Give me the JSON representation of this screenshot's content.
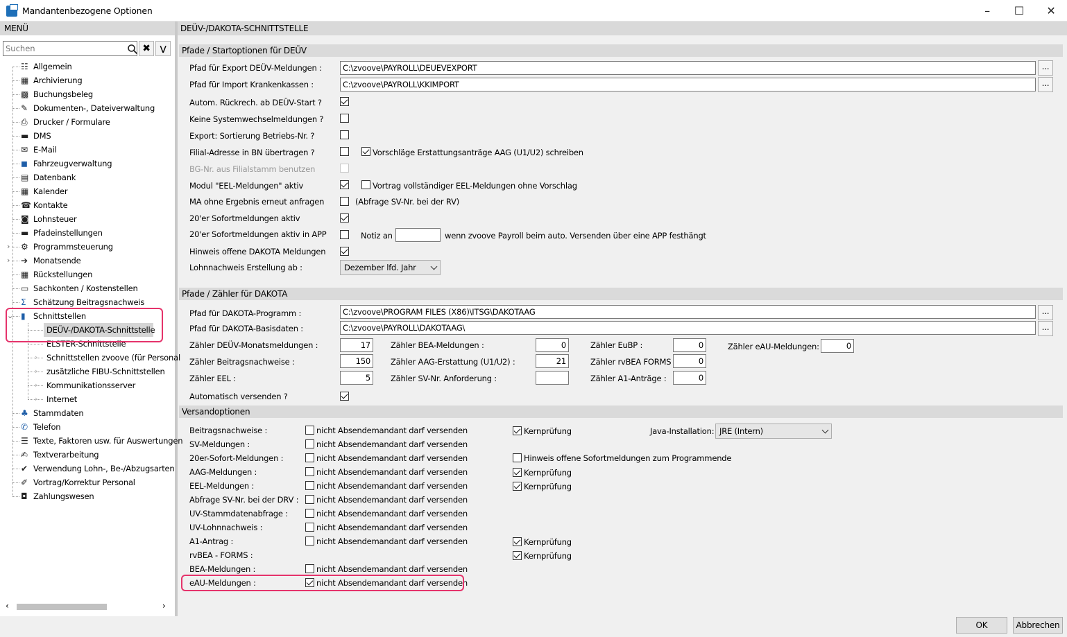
{
  "window": {
    "title": "Mandantenbezogene Optionen"
  },
  "left": {
    "header": "MENÜ",
    "search_placeholder": "Suchen"
  },
  "tree": [
    {
      "label": "Allgemein",
      "icon": "list-icon",
      "level": 0
    },
    {
      "label": "Archivierung",
      "icon": "archive-icon",
      "level": 0
    },
    {
      "label": "Buchungsbeleg",
      "icon": "grid-icon",
      "level": 0
    },
    {
      "label": "Dokumenten-, Dateiverwaltung",
      "icon": "document-icon",
      "level": 0
    },
    {
      "label": "Drucker / Formulare",
      "icon": "printer-icon",
      "level": 0
    },
    {
      "label": "DMS",
      "icon": "folder-icon",
      "level": 0
    },
    {
      "label": "E-Mail",
      "icon": "email-icon",
      "level": 0
    },
    {
      "label": "Fahrzeugverwaltung",
      "icon": "car-icon",
      "level": 0
    },
    {
      "label": "Datenbank",
      "icon": "database-icon",
      "level": 0
    },
    {
      "label": "Kalender",
      "icon": "calendar-icon",
      "level": 0
    },
    {
      "label": "Kontakte",
      "icon": "contacts-icon",
      "level": 0
    },
    {
      "label": "Lohnsteuer",
      "icon": "tax-icon",
      "level": 0
    },
    {
      "label": "Pfadeinstellungen",
      "icon": "folder-icon",
      "level": 0
    },
    {
      "label": "Programmsteuerung",
      "icon": "program-icon",
      "level": 0,
      "expander": ">"
    },
    {
      "label": "Monatsende",
      "icon": "month-end-icon",
      "level": 0,
      "expander": ">"
    },
    {
      "label": "Rückstellungen",
      "icon": "calculator-icon",
      "level": 0
    },
    {
      "label": "Sachkonten / Kostenstellen",
      "icon": "accounts-icon",
      "level": 0
    },
    {
      "label": "Schätzung Beitragsnachweis",
      "icon": "sigma-icon",
      "level": 0
    },
    {
      "label": "Schnittstellen",
      "icon": "book-icon",
      "level": 0,
      "expander": "v"
    },
    {
      "label": "DEÜV-/DAKOTA-Schnittstelle",
      "level": 1,
      "selected": true
    },
    {
      "label": "ELSTER-Schnittstelle",
      "level": 1
    },
    {
      "label": "Schnittstellen zvoove (für Personal",
      "level": 1,
      "expander": ">"
    },
    {
      "label": "zusätzliche FIBU-Schnittstellen",
      "level": 1,
      "expander": ">"
    },
    {
      "label": "Kommunikationsserver",
      "level": 1,
      "expander": ">"
    },
    {
      "label": "Internet",
      "level": 1,
      "expander": ">"
    },
    {
      "label": "Stammdaten",
      "icon": "tree-icon",
      "level": 0
    },
    {
      "label": "Telefon",
      "icon": "phone-icon",
      "level": 0
    },
    {
      "label": "Texte, Faktoren usw. für Auswertungen",
      "icon": "texts-icon",
      "level": 0
    },
    {
      "label": "Textverarbeitung",
      "icon": "text-editor-icon",
      "level": 0
    },
    {
      "label": "Verwendung Lohn-, Be-/Abzugsarten",
      "icon": "wage-icon",
      "level": 0
    },
    {
      "label": "Vortrag/Korrektur Personal",
      "icon": "edit-icon",
      "level": 0
    },
    {
      "label": "Zahlungswesen",
      "icon": "money-icon",
      "level": 0
    }
  ],
  "content": {
    "header": "DEÜV-/DAKOTA-SCHNITTSTELLE"
  },
  "s1": {
    "title": "Pfade / Startoptionen für DEÜV",
    "export_label": "Pfad für Export DEÜV-Meldungen :",
    "export_value": "C:\\zvoove\\PAYROLL\\DEUEVEXPORT",
    "import_label": "Pfad für Import Krankenkassen :",
    "import_value": "C:\\zvoove\\PAYROLL\\KKIMPORT",
    "browse": "...",
    "autom": "Autom. Rückrech. ab DEÜV-Start ?",
    "keine": "Keine Systemwechselmeldungen ?",
    "export_sort": "Export: Sortierung Betriebs-Nr. ?",
    "filial": "Filial-Adresse in BN übertragen ?",
    "vorschlaege": "Vorschläge Erstattungsanträge AAG (U1/U2) schreiben",
    "bgnr": "BG-Nr. aus Filialstamm benutzen",
    "modul": "Modul \"EEL-Meldungen\" aktiv",
    "vortrag": "Vortrag vollständiger EEL-Meldungen ohne Vorschlag",
    "ma": "MA ohne Ergebnis erneut anfragen",
    "abfrage": "(Abfrage SV-Nr. bei der RV)",
    "sofort": "20'er Sofortmeldungen aktiv",
    "sofort_app": "20'er Sofortmeldungen aktiv in APP",
    "notiz": "Notiz an",
    "notiz_value": "",
    "notiz_text": "wenn zvoove Payroll beim auto. Versenden über eine APP festhängt",
    "hinweis": "Hinweis offene DAKOTA Meldungen",
    "lohn": "Lohnnachweis Erstellung ab :",
    "lohn_value": "Dezember lfd. Jahr"
  },
  "s2": {
    "title": "Pfade / Zähler für DAKOTA",
    "prog_label": "Pfad für DAKOTA-Programm :",
    "prog_value": "C:\\zvoove\\PROGRAM FILES (X86)\\ITSG\\DAKOTAAG",
    "basis_label": "Pfad für DAKOTA-Basisdaten :",
    "basis_value": "C:\\zvoove\\PAYROLL\\DAKOTAAG\\",
    "z_deuev": "Zähler DEÜV-Monatsmeldungen :",
    "v_deuev": "17",
    "z_bea": "Zähler BEA-Meldungen :",
    "v_bea": "0",
    "z_eubp": "Zähler EuBP :",
    "v_eubp": "0",
    "z_eau": "Zähler eAU-Meldungen:",
    "v_eau": "0",
    "z_beitrag": "Zähler Beitragsnachweise :",
    "v_beitrag": "150",
    "z_aag": "Zähler AAG-Erstattung (U1/U2) :",
    "v_aag": "21",
    "z_rvbea": "Zähler rvBEA FORMS :",
    "v_rvbea": "0",
    "z_eel": "Zähler EEL :",
    "v_eel": "5",
    "z_svnr": "Zähler SV-Nr. Anforderung :",
    "v_svnr": "",
    "z_a1": "Zähler A1-Anträge :",
    "v_a1": "0",
    "auto": "Automatisch versenden ?"
  },
  "s3": {
    "title": "Versandoptionen",
    "nicht": "nicht Absendemandant darf versenden",
    "kern": "Kernprüfung",
    "java_label": "Java-Installation:",
    "java_value": "JRE (Intern)",
    "hinweis_sofort": "Hinweis offene Sofortmeldungen zum Programmende",
    "rows": [
      {
        "label": "Beitragsnachweise :",
        "nicht": false,
        "kern": true
      },
      {
        "label": "SV-Meldungen :",
        "nicht": false
      },
      {
        "label": "20er-Sofort-Meldungen :",
        "nicht": false
      },
      {
        "label": "AAG-Meldungen :",
        "nicht": false,
        "kern": true
      },
      {
        "label": "EEL-Meldungen :",
        "nicht": false,
        "kern": true
      },
      {
        "label": "Abfrage SV-Nr. bei der DRV :",
        "nicht": false
      },
      {
        "label": "UV-Stammdatenabfrage :",
        "nicht": false
      },
      {
        "label": "UV-Lohnnachweis :",
        "nicht": false
      },
      {
        "label": "A1-Antrag :",
        "nicht": false,
        "kern": true
      },
      {
        "label": "rvBEA - FORMS :",
        "kern": true
      },
      {
        "label": "BEA-Meldungen :",
        "nicht": false
      },
      {
        "label": "eAU-Meldungen :",
        "nicht": true
      }
    ]
  },
  "buttons": {
    "ok": "OK",
    "cancel": "Abbrechen"
  },
  "colors": {
    "highlight": "#e5336b",
    "selected_bg": "#d5d5d5"
  }
}
